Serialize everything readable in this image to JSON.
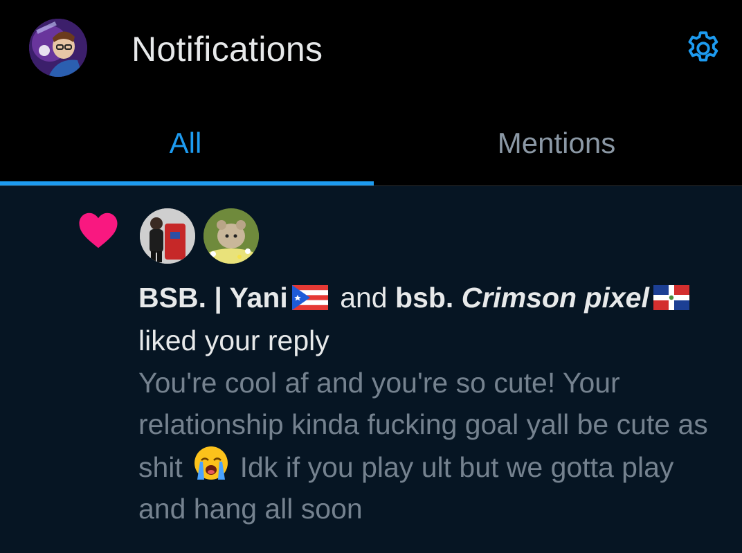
{
  "header": {
    "title": "Notifications",
    "avatar_icon": "user-avatar-icon",
    "settings_icon": "gear-icon"
  },
  "tabs": [
    {
      "label": "All",
      "active": true
    },
    {
      "label": "Mentions",
      "active": false
    }
  ],
  "colors": {
    "accent": "#1d9bf0",
    "like": "#f91880",
    "background": "#000000",
    "card_background": "#061523",
    "muted_text": "#75828f"
  },
  "notification": {
    "type_icon": "heart-icon",
    "user1": "BSB. | Yani",
    "user1_flag": "puerto-rico-flag-icon",
    "connector": "and",
    "user2_prefix": "bsb.",
    "user2_styled": "Crimson pixel",
    "user2_flag": "dominican-republic-flag-icon",
    "action": "liked your reply",
    "reply_part1": "You're cool af and you're so cute! Your relationship kinda fucking goal yall be cute as shit",
    "reply_emoji": "crying-face-emoji",
    "reply_part2": "Idk if you play ult but we gotta play and hang all soon"
  }
}
